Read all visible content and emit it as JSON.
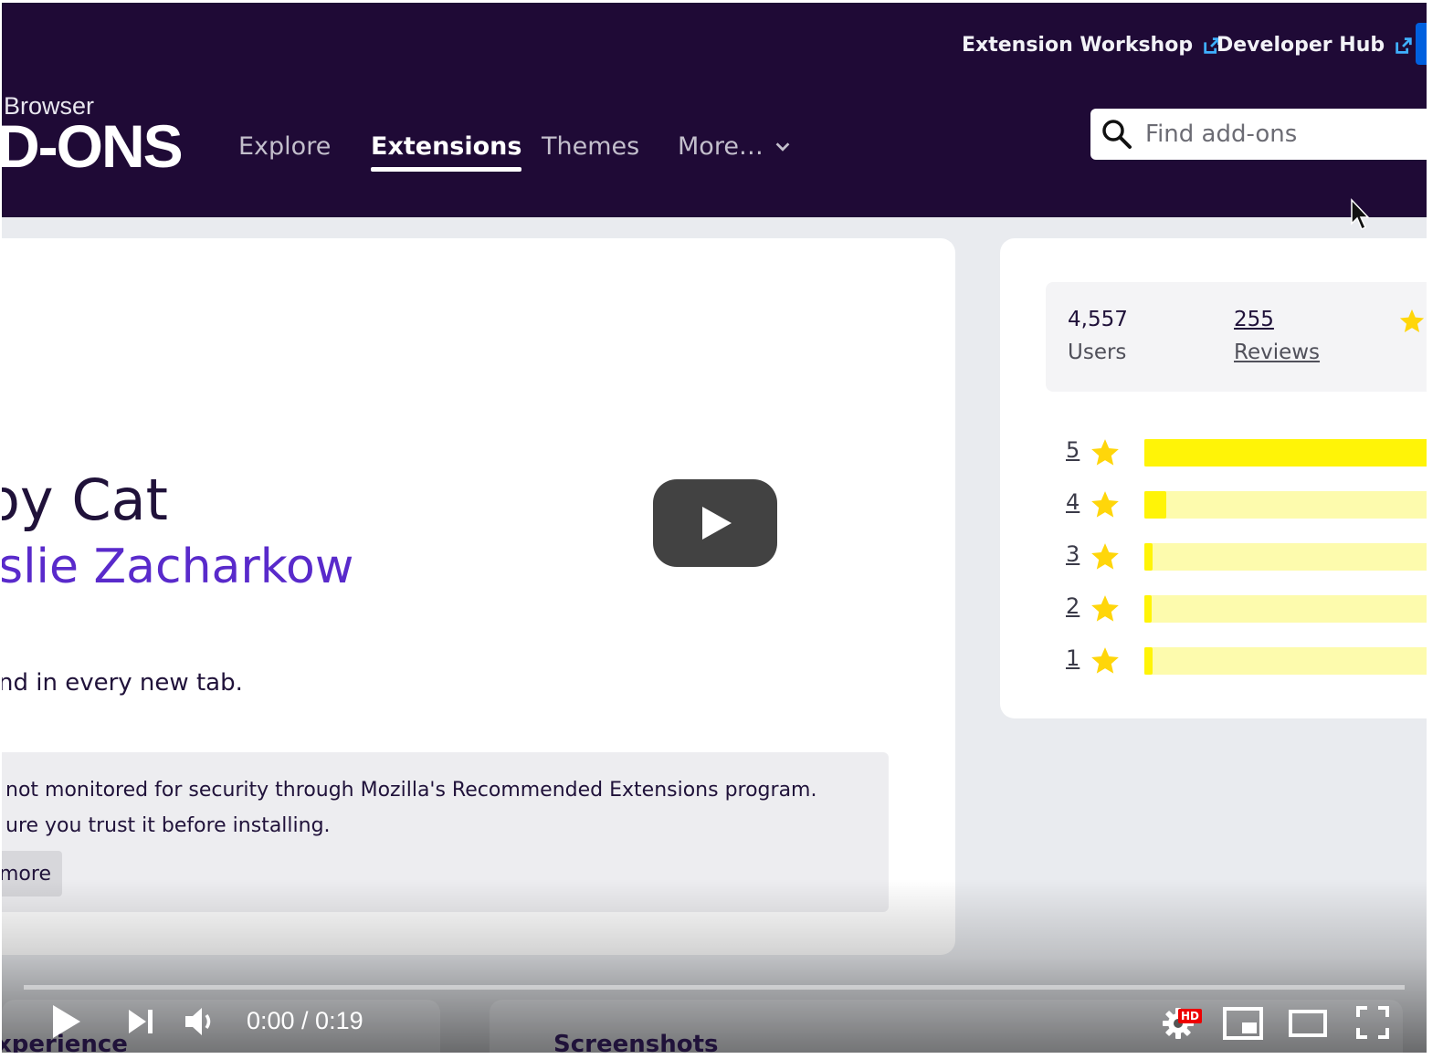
{
  "header": {
    "top_links": {
      "workshop": "Extension Workshop",
      "devhub": "Developer Hub"
    },
    "logo": {
      "small": "Browser",
      "big": "D-ONS"
    },
    "nav": {
      "explore": "Explore",
      "extensions": "Extensions",
      "themes": "Themes",
      "more": "More…"
    },
    "search": {
      "placeholder": "Find add-ons"
    }
  },
  "addon": {
    "name": "oy Cat",
    "author": "slie Zacharkow",
    "summary": "nd in every new tab.",
    "notice": {
      "line1": "not monitored for security through Mozilla's Recommended Extensions program.",
      "line2": "ure you trust it before installing.",
      "button": "more"
    }
  },
  "stats": {
    "users_count": "4,557",
    "users_label": "Users",
    "reviews_count": "255",
    "reviews_label": "Reviews"
  },
  "ratings": [
    {
      "stars": "5",
      "share": 1.0
    },
    {
      "stars": "4",
      "share": 0.07
    },
    {
      "stars": "3",
      "share": 0.025
    },
    {
      "stars": "2",
      "share": 0.015
    },
    {
      "stars": "1",
      "share": 0.025
    }
  ],
  "colors": {
    "header_bg": "#1f0a36",
    "author": "#592acb",
    "rating_fill": "#fff407",
    "rating_track": "#fdfbad",
    "star": "#ffd60a",
    "link_blue": "#0060df"
  },
  "video": {
    "time": "0:00 / 0:19",
    "progress": 0.0,
    "hd_badge": "HD",
    "below_tabs": {
      "experience": "xperience",
      "screenshots": "Screenshots"
    }
  }
}
